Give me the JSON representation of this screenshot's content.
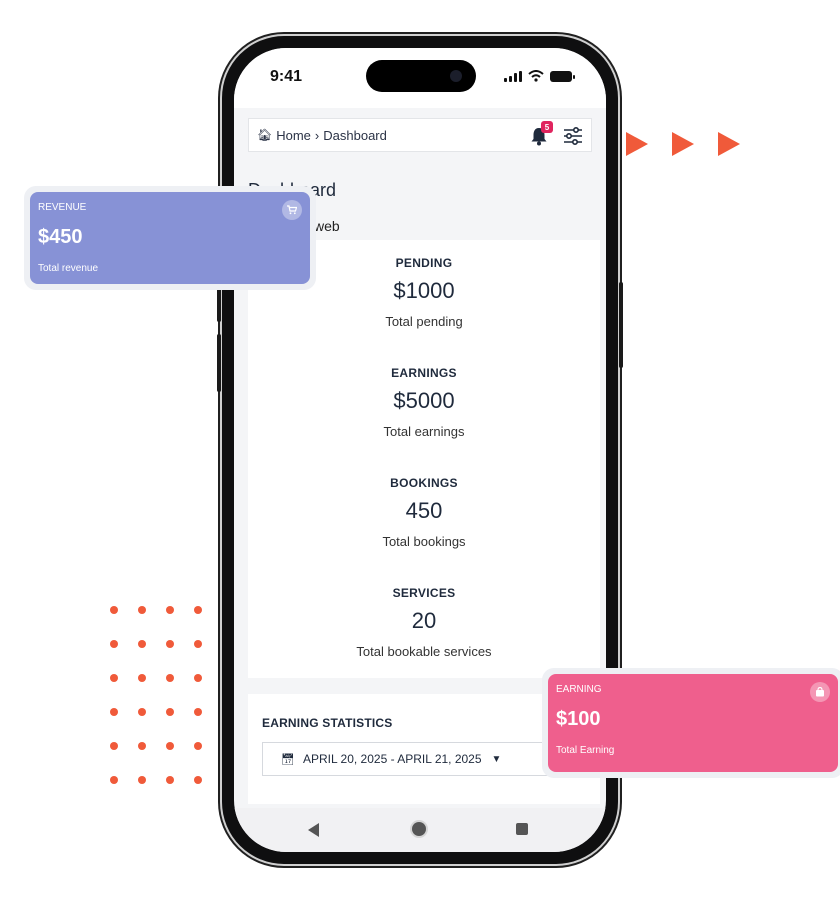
{
  "status_bar": {
    "time": "9:41"
  },
  "breadcrumb": {
    "home": "Home",
    "separator": "›",
    "current": "Dashboard"
  },
  "notifications": {
    "count": "5"
  },
  "page": {
    "title": "Dashboard",
    "subtitle": "web"
  },
  "stats": [
    {
      "label": "PENDING",
      "value": "$1000",
      "desc": "Total pending"
    },
    {
      "label": "EARNINGS",
      "value": "$5000",
      "desc": "Total earnings"
    },
    {
      "label": "BOOKINGS",
      "value": "450",
      "desc": "Total bookings"
    },
    {
      "label": "SERVICES",
      "value": "20",
      "desc": "Total bookable services"
    }
  ],
  "earning_statistics": {
    "title": "EARNING STATISTICS",
    "date_range": "APRIL 20, 2025 - APRIL 21, 2025"
  },
  "floating_cards": {
    "revenue": {
      "label": "REVENUE",
      "value": "$450",
      "desc": "Total revenue",
      "color": "#8792d6",
      "icon": "cart-icon"
    },
    "earning": {
      "label": "EARNING",
      "value": "$100",
      "desc": "Total Earning",
      "color": "#ef5f8d",
      "icon": "bag-icon"
    }
  },
  "colors": {
    "accent": "#f05a3a"
  }
}
